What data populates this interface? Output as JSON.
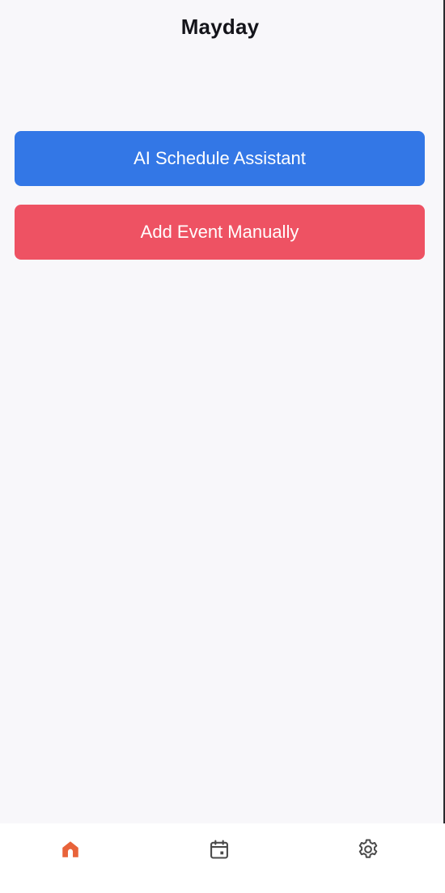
{
  "header": {
    "title": "Mayday"
  },
  "actions": {
    "ai_assistant_label": "AI Schedule Assistant",
    "add_event_label": "Add Event Manually"
  },
  "tabbar": {
    "items": [
      {
        "icon": "home-icon",
        "active": true
      },
      {
        "icon": "calendar-icon",
        "active": false
      },
      {
        "icon": "gear-icon",
        "active": false
      }
    ]
  },
  "colors": {
    "background": "#f8f7fa",
    "ai_button": "#3377e6",
    "add_event_button": "#ee5263",
    "tab_active": "#e8633a",
    "tab_inactive": "#4a4a4a"
  }
}
